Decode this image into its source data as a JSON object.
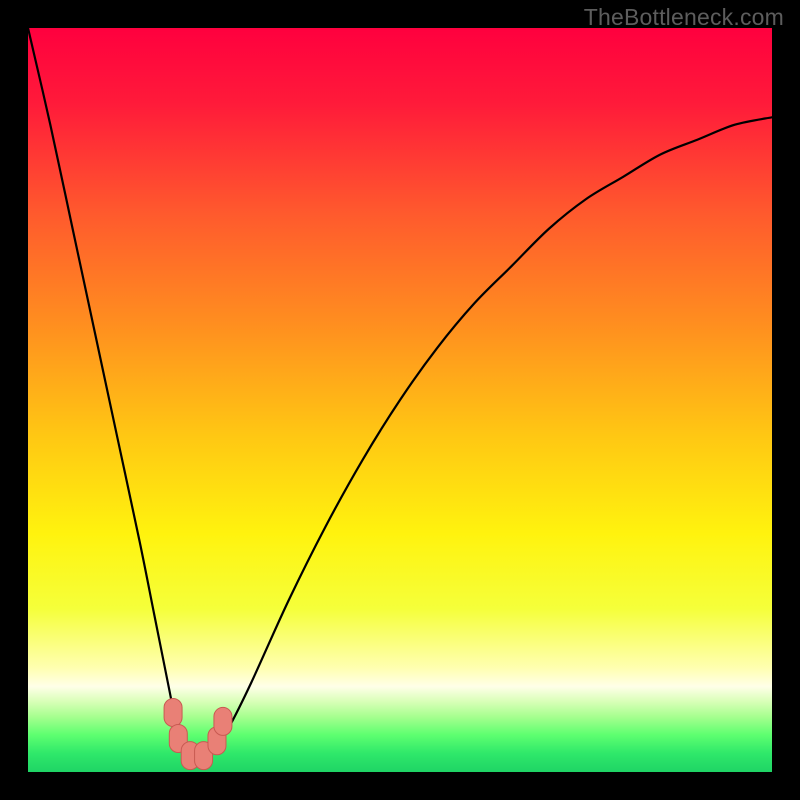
{
  "watermark": {
    "text": "TheBottleneck.com"
  },
  "chart_data": {
    "type": "line",
    "title": "",
    "xlabel": "",
    "ylabel": "",
    "xlim": [
      0,
      100
    ],
    "ylim": [
      0,
      100
    ],
    "series": [
      {
        "name": "bottleneck-curve",
        "x": [
          0,
          3,
          6,
          9,
          12,
          15,
          17,
          19,
          20,
          21,
          22,
          23,
          24,
          25,
          27,
          30,
          35,
          40,
          45,
          50,
          55,
          60,
          65,
          70,
          75,
          80,
          85,
          90,
          95,
          100
        ],
        "values": [
          100,
          87,
          73,
          59,
          45,
          31,
          21,
          11,
          6,
          3,
          2,
          2,
          2,
          3,
          6,
          12,
          23,
          33,
          42,
          50,
          57,
          63,
          68,
          73,
          77,
          80,
          83,
          85,
          87,
          88
        ]
      }
    ],
    "markers": [
      {
        "x": 19.5,
        "y": 8.0,
        "name": "marker-left-upper"
      },
      {
        "x": 20.2,
        "y": 4.5,
        "name": "marker-left-lower"
      },
      {
        "x": 21.8,
        "y": 2.2,
        "name": "marker-bottom-left"
      },
      {
        "x": 23.6,
        "y": 2.2,
        "name": "marker-bottom-right"
      },
      {
        "x": 25.4,
        "y": 4.2,
        "name": "marker-right-lower"
      },
      {
        "x": 26.2,
        "y": 6.8,
        "name": "marker-right-upper"
      }
    ],
    "gradient_stops": [
      {
        "offset": 0.0,
        "color": "#ff003e"
      },
      {
        "offset": 0.1,
        "color": "#ff1a3a"
      },
      {
        "offset": 0.25,
        "color": "#ff5a2d"
      },
      {
        "offset": 0.4,
        "color": "#ff8f1f"
      },
      {
        "offset": 0.55,
        "color": "#ffc813"
      },
      {
        "offset": 0.68,
        "color": "#fff30e"
      },
      {
        "offset": 0.78,
        "color": "#f5ff3a"
      },
      {
        "offset": 0.86,
        "color": "#ffffb0"
      },
      {
        "offset": 0.885,
        "color": "#ffffe8"
      },
      {
        "offset": 0.905,
        "color": "#d9ffb8"
      },
      {
        "offset": 0.925,
        "color": "#a8ff90"
      },
      {
        "offset": 0.95,
        "color": "#5eff70"
      },
      {
        "offset": 0.975,
        "color": "#2fe86a"
      },
      {
        "offset": 1.0,
        "color": "#1fd465"
      }
    ],
    "curve_color": "#000000",
    "marker_fill": "#e98076",
    "marker_stroke": "#c85a52"
  }
}
